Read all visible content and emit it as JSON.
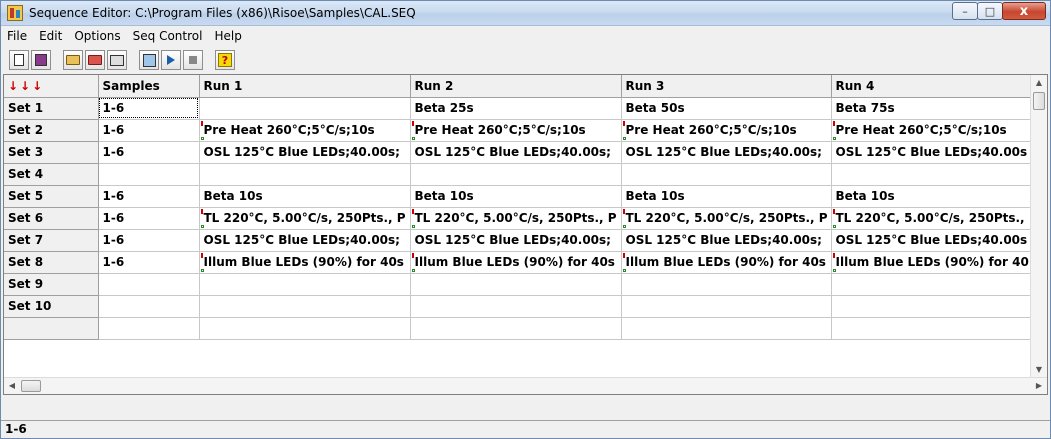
{
  "window": {
    "title": "Sequence Editor: C:\\Program Files (x86)\\Risoe\\Samples\\CAL.SEQ",
    "minimize_glyph": "–",
    "maximize_glyph": "□",
    "close_glyph": "x"
  },
  "menu": [
    "File",
    "Edit",
    "Options",
    "Seq Control",
    "Help"
  ],
  "toolbar_icons": [
    "new-document-icon",
    "save-icon",
    "open-folder-icon",
    "open-red-folder-icon",
    "print-icon",
    "edit-icon",
    "run-icon",
    "stop-icon",
    "help-icon"
  ],
  "toolbar_help_glyph": "?",
  "grid": {
    "corner": "↓↓↓",
    "columns": [
      "Samples",
      "Run 1",
      "Run 2",
      "Run 3",
      "Run 4"
    ],
    "rows": [
      {
        "label": "Set 1",
        "samples": "1-6",
        "runs": [
          "",
          "Beta 25s",
          "Beta 50s",
          "Beta 75s"
        ]
      },
      {
        "label": "Set 2",
        "samples": "1-6",
        "runs": [
          "Pre Heat 260°C;5°C/s;10s",
          "Pre Heat 260°C;5°C/s;10s",
          "Pre Heat 260°C;5°C/s;10s",
          "Pre Heat 260°C;5°C/s;10s"
        ]
      },
      {
        "label": "Set 3",
        "samples": "1-6",
        "runs": [
          "OSL 125°C Blue LEDs;40.00s;",
          "OSL 125°C Blue LEDs;40.00s;",
          "OSL 125°C Blue LEDs;40.00s;",
          "OSL 125°C Blue LEDs;40.00s"
        ]
      },
      {
        "label": "Set 4",
        "samples": "",
        "runs": [
          "",
          "",
          "",
          ""
        ]
      },
      {
        "label": "Set 5",
        "samples": "1-6",
        "runs": [
          "Beta 10s",
          "Beta 10s",
          "Beta 10s",
          "Beta 10s"
        ]
      },
      {
        "label": "Set 6",
        "samples": "1-6",
        "runs": [
          "TL 220°C, 5.00°C/s, 250Pts., P",
          "TL 220°C, 5.00°C/s, 250Pts., P",
          "TL 220°C, 5.00°C/s, 250Pts., P",
          "TL 220°C, 5.00°C/s, 250Pts.,"
        ]
      },
      {
        "label": "Set 7",
        "samples": "1-6",
        "runs": [
          "OSL 125°C Blue LEDs;40.00s;",
          "OSL 125°C Blue LEDs;40.00s;",
          "OSL 125°C Blue LEDs;40.00s;",
          "OSL 125°C Blue LEDs;40.00s"
        ]
      },
      {
        "label": "Set 8",
        "samples": "1-6",
        "runs": [
          "Illum Blue LEDs (90%) for 40s",
          "Illum Blue LEDs (90%) for 40s",
          "Illum Blue LEDs (90%) for 40s",
          "Illum Blue LEDs (90%) for 40"
        ]
      },
      {
        "label": "Set 9",
        "samples": "",
        "runs": [
          "",
          "",
          "",
          ""
        ]
      },
      {
        "label": "Set 10",
        "samples": "",
        "runs": [
          "",
          "",
          "",
          ""
        ]
      },
      {
        "label": "",
        "samples": "",
        "runs": [
          "",
          "",
          "",
          ""
        ]
      }
    ]
  },
  "status": "1-6"
}
